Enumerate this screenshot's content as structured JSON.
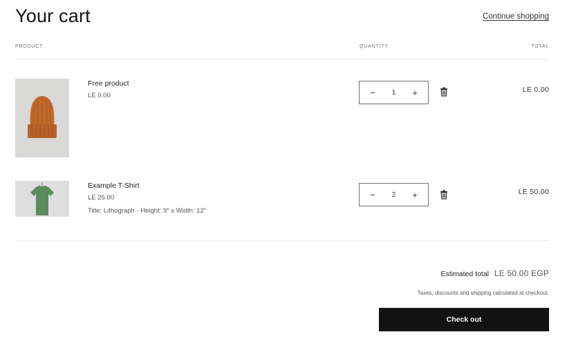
{
  "header": {
    "title": "Your cart",
    "continue_label": "Continue shopping"
  },
  "columns": {
    "product": "PRODUCT",
    "quantity": "QUANTITY",
    "total": "TOTAL"
  },
  "items": [
    {
      "name": "Free product",
      "price": "LE 0.00",
      "variant": "",
      "quantity": "1",
      "line_total": "LE 0.00",
      "image_icon": "orange-beanie-hat"
    },
    {
      "name": "Example T-Shirt",
      "price": "LE 25.00",
      "variant": "Title: Lithograph - Height: 9\" x Width: 12\"",
      "quantity": "2",
      "line_total": "LE 50.00",
      "image_icon": "green-t-shirt"
    }
  ],
  "qty_controls": {
    "minus": "−",
    "plus": "+"
  },
  "summary": {
    "estimated_label": "Estimated total",
    "estimated_value": "LE 50.00 EGP",
    "tax_note": "Taxes, discounts and shipping calculated at checkout.",
    "checkout_label": "Check out"
  },
  "colors": {
    "checkout_bg": "#121212",
    "hat": "#c0692c",
    "shirt": "#5b8a5c"
  }
}
